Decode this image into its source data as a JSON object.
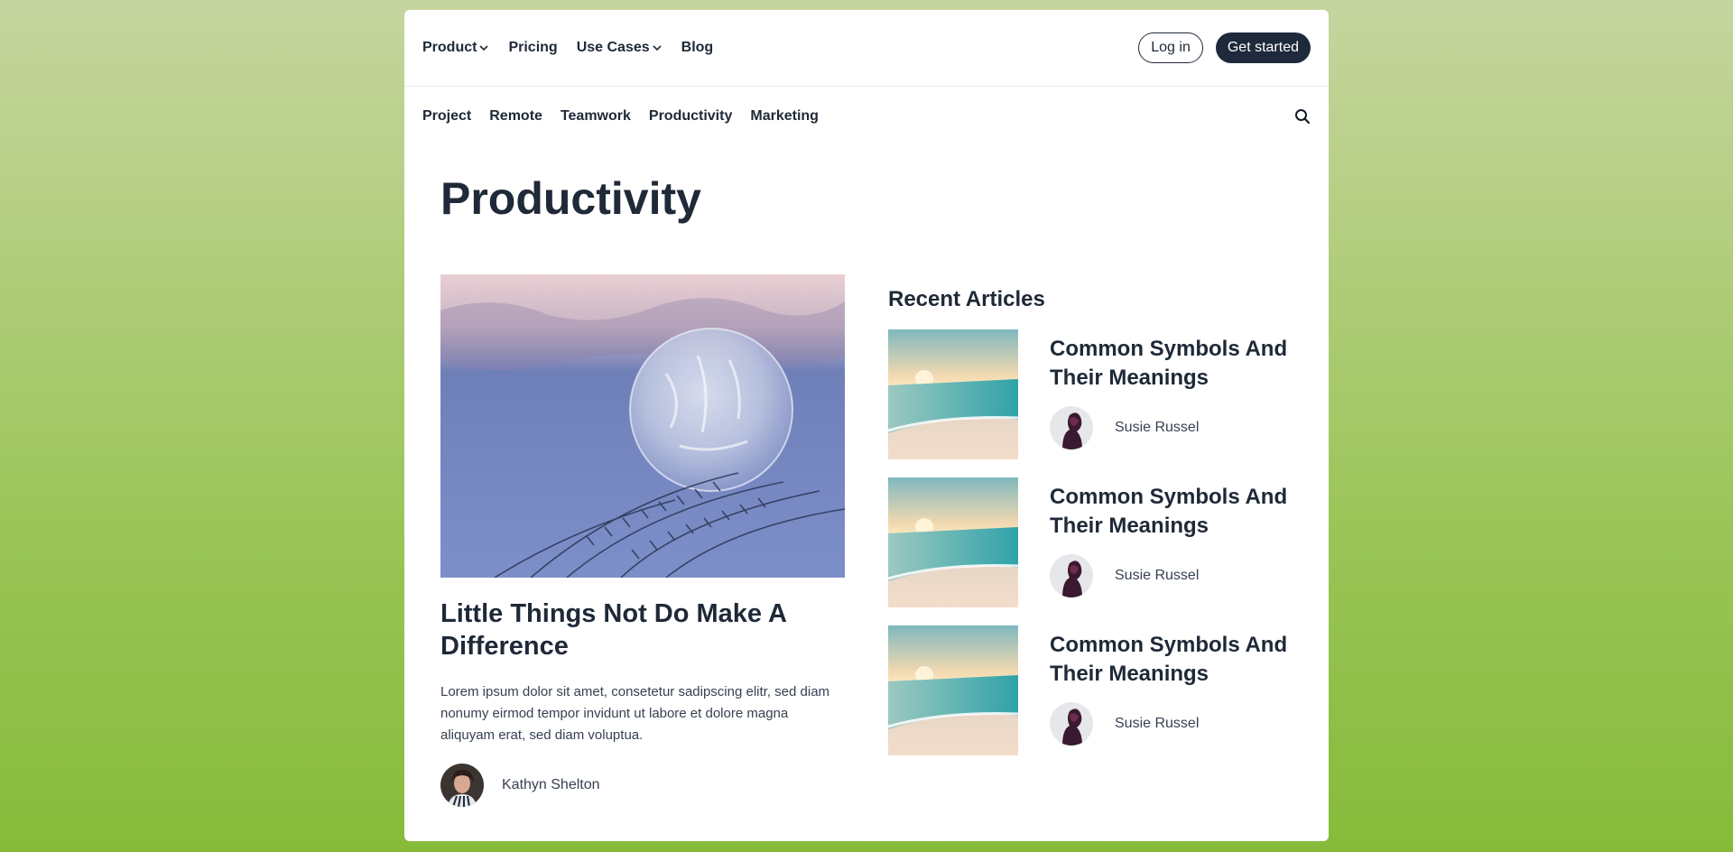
{
  "topnav": {
    "links": [
      {
        "label": "Product",
        "has_dropdown": true
      },
      {
        "label": "Pricing",
        "has_dropdown": false
      },
      {
        "label": "Use Cases",
        "has_dropdown": true
      },
      {
        "label": "Blog",
        "has_dropdown": false
      }
    ],
    "login_label": "Log in",
    "cta_label": "Get started"
  },
  "subnav": {
    "items": [
      "Project",
      "Remote",
      "Teamwork",
      "Productivity",
      "Marketing"
    ],
    "search_icon": "search-icon"
  },
  "page": {
    "title": "Productivity"
  },
  "featured": {
    "image": "frozen-bubble-photo",
    "title": "Little Things Not Do Make A Difference",
    "excerpt": "Lorem ipsum dolor sit amet, consetetur sadipscing elitr, sed diam nonumy eirmod tempor invidunt ut labore et dolore magna aliquyam erat, sed diam voluptua.",
    "author": "Kathyn Shelton"
  },
  "recent": {
    "heading": "Recent Articles",
    "articles": [
      {
        "title": "Common Symbols And Their Meanings",
        "author": "Susie Russel",
        "image": "beach-sunset-photo"
      },
      {
        "title": "Common Symbols And Their Meanings",
        "author": "Susie Russel",
        "image": "beach-sunset-photo"
      },
      {
        "title": "Common Symbols And Their Meanings",
        "author": "Susie Russel",
        "image": "beach-sunset-photo"
      }
    ]
  },
  "colors": {
    "text": "#1f2937",
    "button_dark": "#1e293b",
    "bg_gradient_top": "#c6d59f",
    "bg_gradient_bottom": "#86bb3a"
  }
}
